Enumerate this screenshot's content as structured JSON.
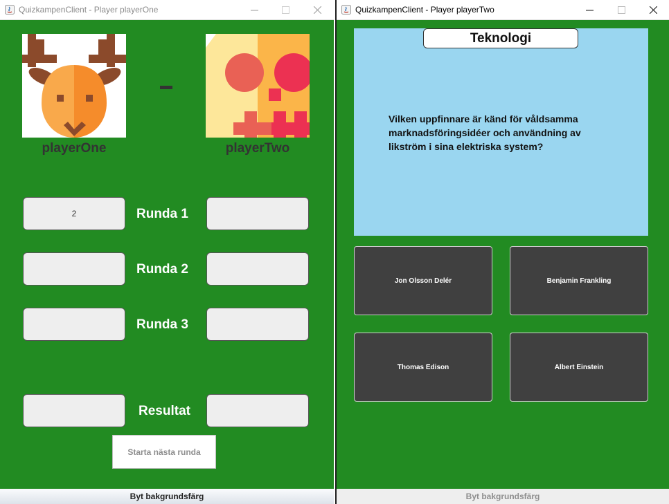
{
  "window_left": {
    "title": "QuizkampenClient - Player playerOne",
    "player_one": {
      "name": "playerOne",
      "avatar": "deer-avatar"
    },
    "separator": "–",
    "player_two": {
      "name": "playerTwo",
      "avatar": "skull-avatar"
    },
    "rounds": [
      {
        "label": "Runda 1",
        "left_score": "2",
        "right_score": ""
      },
      {
        "label": "Runda 2",
        "left_score": "",
        "right_score": ""
      },
      {
        "label": "Runda 3",
        "left_score": "",
        "right_score": ""
      }
    ],
    "result": {
      "label": "Resultat",
      "left_score": "",
      "right_score": ""
    },
    "next_round_button": "Starta nästa runda",
    "bg_button": "Byt bakgrundsfärg"
  },
  "window_right": {
    "title": "QuizkampenClient - Player playerTwo",
    "category": "Teknologi",
    "question": "Vilken uppfinnare är känd för våldsamma marknadsföringsidéer och användning av likström i sina elektriska system?",
    "answers": [
      "Jon Olsson Delér",
      "Benjamin Frankling",
      "Thomas Edison",
      "Albert Einstein"
    ],
    "bg_button": "Byt bakgrundsfärg"
  },
  "colors": {
    "background_green": "#228b22",
    "question_panel": "#9ad6f0",
    "answer_button": "#404040",
    "score_box": "#eeeeee"
  }
}
